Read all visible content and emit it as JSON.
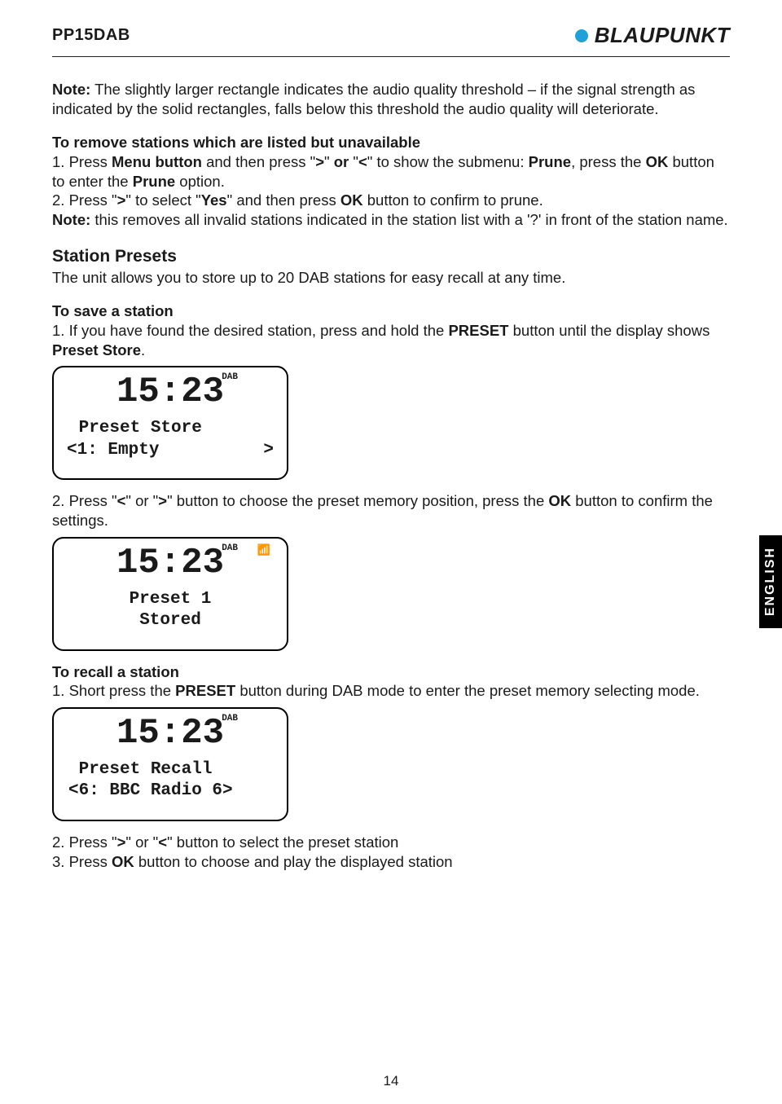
{
  "header": {
    "model": "PP15DAB",
    "brand": "BLAUPUNKT"
  },
  "note1_label": "Note:",
  "note1_text": " The slightly larger rectangle indicates the audio quality threshold – if the signal strength as indicated by the solid rectangles, falls below this threshold the audio quality will deteriorate.",
  "remove_title": "To remove stations which are listed but unavailable",
  "remove_step1_a": "1. Press ",
  "remove_step1_b": "Menu button",
  "remove_step1_c": " and then press \"",
  "remove_step1_d": ">",
  "remove_step1_e": "\" ",
  "remove_step1_f": "or",
  "remove_step1_g": " \"",
  "remove_step1_h": "<",
  "remove_step1_i": "\" to show the submenu: ",
  "remove_step1_j": "Prune",
  "remove_step1_k": ", press the ",
  "remove_step1_l": "OK",
  "remove_step1_m": " button to enter the ",
  "remove_step1_n": "Prune",
  "remove_step1_o": " option.",
  "remove_step2_a": "2. Press \"",
  "remove_step2_b": ">",
  "remove_step2_c": "\" to select \"",
  "remove_step2_d": "Yes",
  "remove_step2_e": "\" and then press ",
  "remove_step2_f": "OK",
  "remove_step2_g": " button to confirm to prune.",
  "remove_note_a": "Note:",
  "remove_note_b": " this removes all invalid stations indicated in the station list with a '?' in front of the station name.",
  "presets_title": "Station Presets",
  "presets_text": "The unit allows you to store up to 20 DAB stations for easy recall at any time.",
  "save_title": "To save a station",
  "save_step1_a": "1. If you have found the desired station, press and hold the ",
  "save_step1_b": "PRESET",
  "save_step1_c": " button until the display shows ",
  "save_step1_d": "Preset Store",
  "save_step1_e": ".",
  "lcd1": {
    "time": "15:23",
    "tag": "DAB",
    "signal": "",
    "line1": " Preset Store",
    "line2_left": "<1: Empty",
    "line2_right": ">"
  },
  "save_step2_a": "2. Press \"",
  "save_step2_b": "<",
  "save_step2_c": "\" or \"",
  "save_step2_d": ">",
  "save_step2_e": "\" button to choose the preset memory position, press the ",
  "save_step2_f": "OK",
  "save_step2_g": " button to confirm the settings.",
  "lcd2": {
    "time": "15:23",
    "tag": "DAB",
    "signal": "📶",
    "line1": "Preset 1",
    "line2": "Stored"
  },
  "recall_title": "To recall a station",
  "recall_step1_a": "1. Short press the ",
  "recall_step1_b": "PRESET",
  "recall_step1_c": " button during DAB mode to enter the preset memory selecting mode.",
  "lcd3": {
    "time": "15:23",
    "tag": "DAB",
    "signal": "",
    "line1": " Preset Recall",
    "line2": "<6: BBC Radio 6>"
  },
  "recall_step2_a": "2. Press \"",
  "recall_step2_b": ">",
  "recall_step2_c": "\" or \"",
  "recall_step2_d": "<",
  "recall_step2_e": "\" button to select the preset station",
  "recall_step3_a": "3. Press ",
  "recall_step3_b": "OK",
  "recall_step3_c": " button to choose and play the displayed station",
  "lang_tab": "ENGLISH",
  "page_number": "14"
}
